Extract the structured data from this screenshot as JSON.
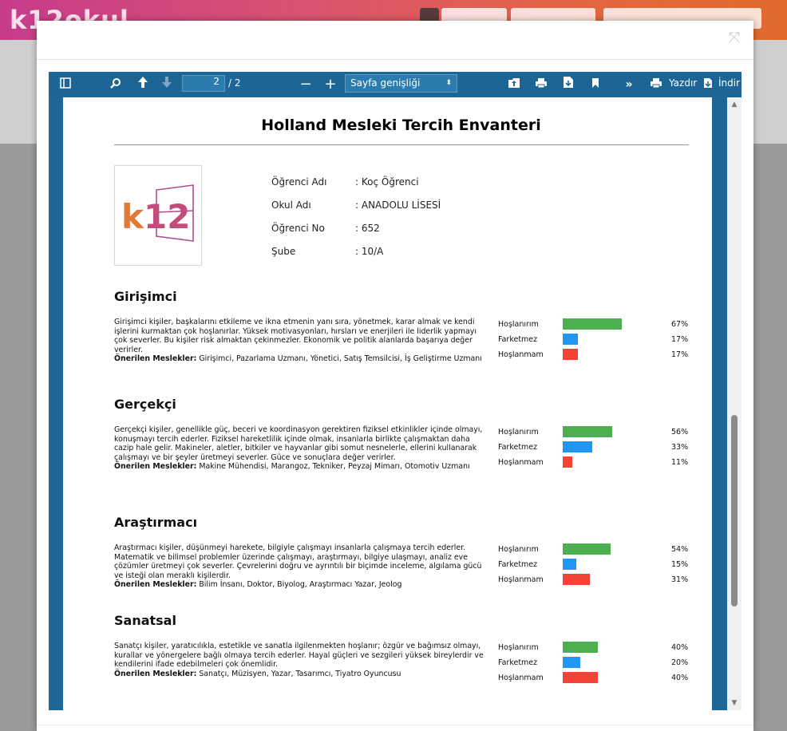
{
  "background": {
    "logo_text": "k12okul",
    "colors": {
      "accent_start": "#c63c8b",
      "accent_end": "#e06a2d"
    }
  },
  "modal": {
    "close_icon": "expand-arrows-icon"
  },
  "viewer": {
    "toolbar": {
      "page_current": "2",
      "page_total": "/ 2",
      "zoom_value": "Sayfa genişliği",
      "print_label": "Yazdır",
      "download_label": "İndir"
    },
    "colors": {
      "toolbar": "#1c6594",
      "bar_like": "#4caf50",
      "bar_neutral": "#2196f3",
      "bar_dislike": "#f44336"
    }
  },
  "document": {
    "title": "Holland Mesleki Tercih Envanteri",
    "logo_text": "k12",
    "info": [
      {
        "label": "Öğrenci Adı",
        "value": ": Koç Öğrenci"
      },
      {
        "label": "Okul Adı",
        "value": ": ANADOLU LİSESİ"
      },
      {
        "label": "Öğrenci No",
        "value": ": 652"
      },
      {
        "label": "Şube",
        "value": ": 10/A"
      }
    ],
    "bar_labels": {
      "like": "Hoşlanırım",
      "neutral": "Farketmez",
      "dislike": "Hoşlanmam"
    },
    "recommended_label": "Önerilen Meslekler:",
    "sections": [
      {
        "title": "Girişimci",
        "description": "Girişimci kişiler, başkalarını etkileme ve ikna etmenin yanı sıra, yönetmek, karar almak ve kendi işlerini kurmaktan çok hoşlanırlar. Yüksek motivasyonları, hırsları ve enerjileri ile liderlik yapmayı çok severler. Bu kişiler risk almaktan çekinmezler. Ekonomik ve politik alanlarda başarıya değer verirler.",
        "recommended": " Girişimci, Pazarlama Uzmanı, Yönetici, Satış Temsilcisi, İş Geliştirme Uzmanı",
        "like": "67%",
        "neutral": "17%",
        "dislike": "17%"
      },
      {
        "title": "Gerçekçi",
        "description": "Gerçekçi kişiler, genellikle güç, beceri ve koordinasyon gerektiren fiziksel etkinlikler içinde olmayı, konuşmayı tercih ederler. Fiziksel hareketlilik içinde olmak, insanlarla birlikte çalışmaktan daha cazip hale gelir. Makineler, aletler, bitkiler ve hayvanlar gibi somut nesnelerle, ellerini kullanarak çalışmayı ve bir şeyler üretmeyi severler. Güce ve sonuçlara değer verirler.",
        "recommended": " Makine Mühendisi, Marangoz, Tekniker, Peyzaj Mimarı, Otomotiv Uzmanı",
        "like": "56%",
        "neutral": "33%",
        "dislike": "11%"
      },
      {
        "title": "Araştırmacı",
        "description": "Araştırmacı kişiler, düşünmeyi harekete, bilgiyle çalışmayı insanlarla çalışmaya tercih ederler. Matematik ve bilimsel problemler üzerinde çalışmayı, araştırmayı, bilgiye ulaşmayı, analiz eve çözümler üretmeyi çok severler. Çevrelerini doğru ve ayrıntılı bir biçimde inceleme, algılama gücü ve isteği olan meraklı kişilerdir.",
        "recommended": " Bilim İnsanı, Doktor, Biyolog, Araştırmacı Yazar, Jeolog",
        "like": "54%",
        "neutral": "15%",
        "dislike": "31%"
      },
      {
        "title": "Sanatsal",
        "description": "Sanatçı kişiler, yaratıcılıkla, estetikle ve sanatla ilgilenmekten hoşlanır; özgür ve bağımsız olmayı, kurallar ve yönergelere bağlı olmaya tercih ederler. Hayal güçleri ve sezgileri yüksek bireylerdir ve kendilerini ifade edebilmeleri çok önemlidir.",
        "recommended": " Sanatçı, Müzisyen, Yazar, Tasarımcı, Tiyatro Oyuncusu",
        "like": "40%",
        "neutral": "20%",
        "dislike": "40%"
      }
    ],
    "bar_values": [
      {
        "like": 0.67,
        "neutral": 0.17,
        "dislike": 0.17
      },
      {
        "like": 0.56,
        "neutral": 0.33,
        "dislike": 0.11
      },
      {
        "like": 0.54,
        "neutral": 0.15,
        "dislike": 0.31
      },
      {
        "like": 0.4,
        "neutral": 0.2,
        "dislike": 0.4
      }
    ]
  }
}
